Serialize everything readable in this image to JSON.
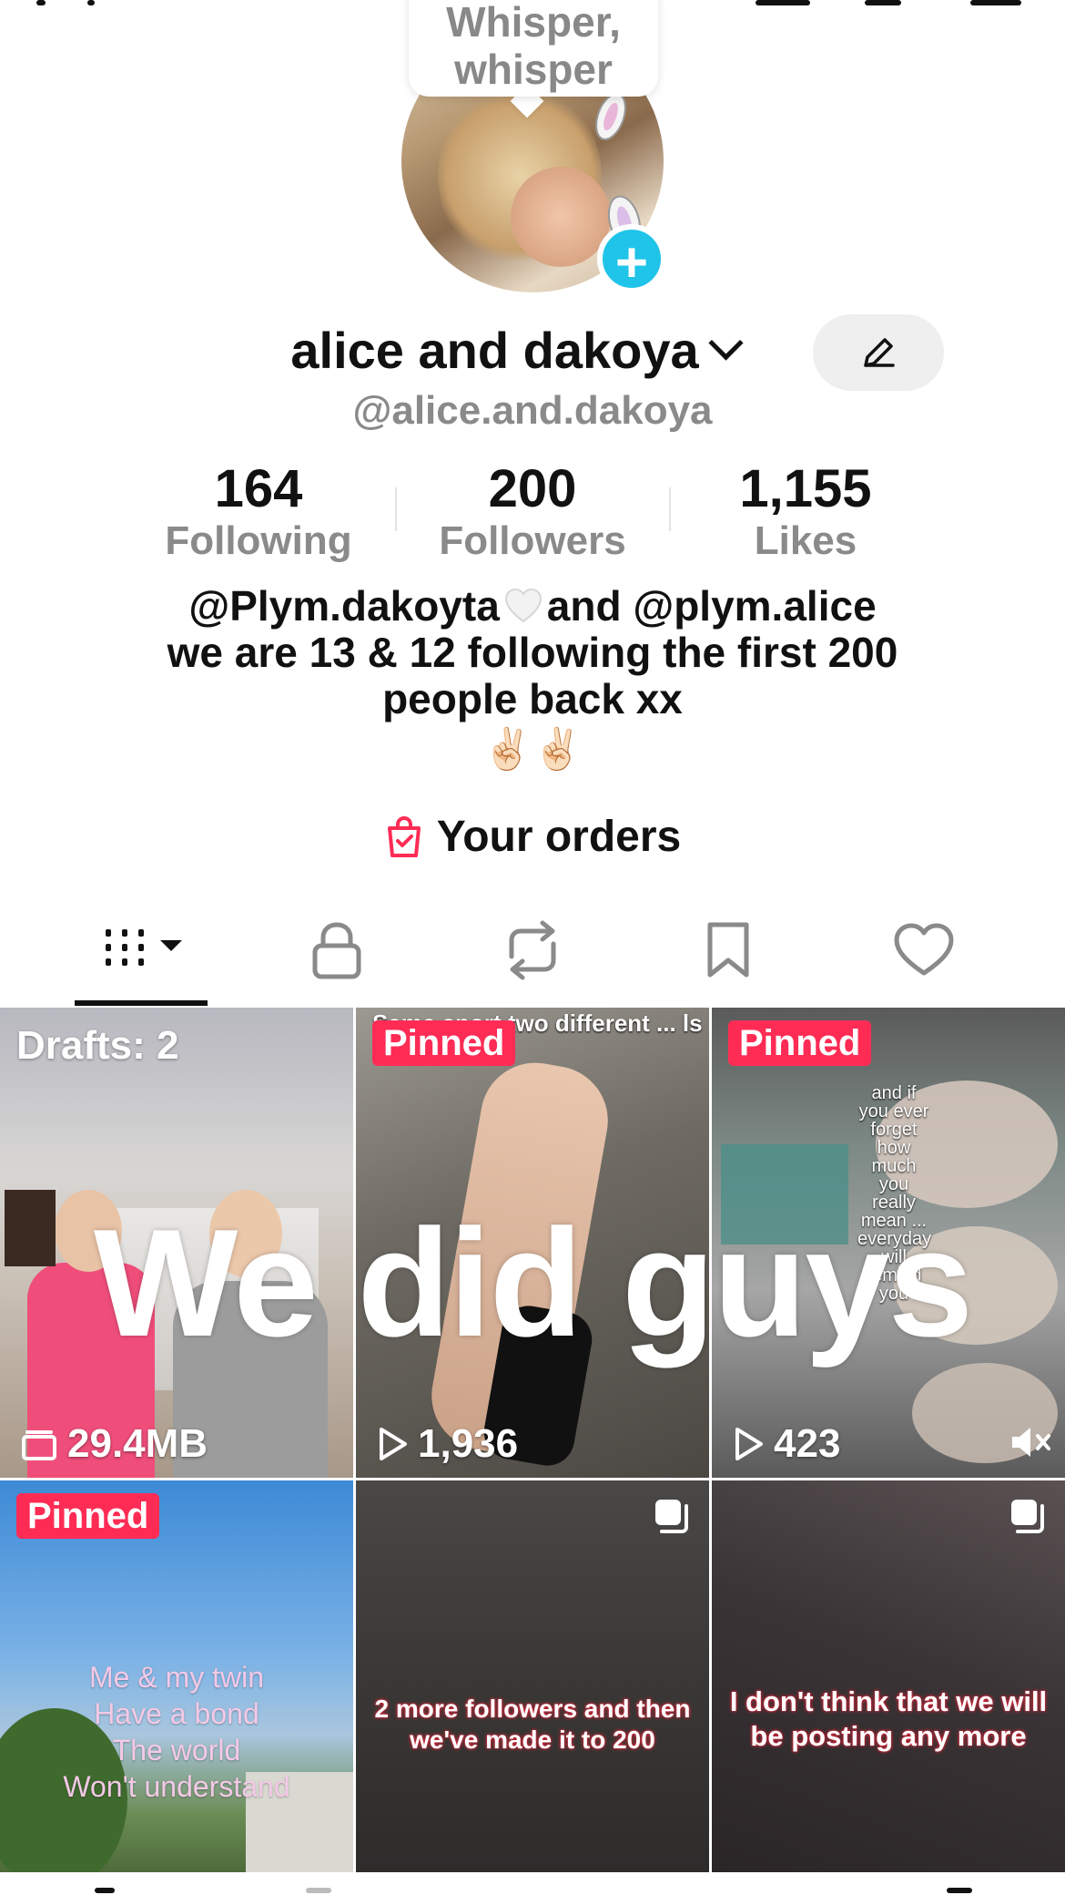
{
  "bubble": {
    "line1": "Whisper,",
    "line2": "whisper"
  },
  "profile": {
    "name": "alice and dakoya",
    "handle": "@alice.and.dakoya"
  },
  "stats": [
    {
      "value": "164",
      "label": "Following"
    },
    {
      "value": "200",
      "label": "Followers"
    },
    {
      "value": "1,155",
      "label": "Likes"
    }
  ],
  "bio": {
    "line1_a": "@Plym.dakoyta",
    "line1_b": "and @plym.alice",
    "line2": "we are 13 & 12 following the first 200",
    "line3": "people back xx",
    "line4": "✌🏻✌🏻"
  },
  "orders": {
    "label": "Your orders"
  },
  "tabs": [
    "videos-grid",
    "private",
    "reposts",
    "favorites",
    "liked"
  ],
  "grid": [
    {
      "badge": "Drafts: 2",
      "footer": "29.4MB"
    },
    {
      "badge": "Pinned",
      "caption": "Same sport two different ... ls",
      "views": "1,936"
    },
    {
      "badge": "Pinned",
      "caption": "and if you ever forget how much you really mean ... everyday will remind you",
      "views": "423"
    },
    {
      "badge": "Pinned",
      "caption_lines": [
        "Me & my twin",
        "Have a bond",
        "The world",
        "Won't understand"
      ]
    },
    {
      "caption_lines": [
        "2 more followers and then",
        "we've made it to 200"
      ]
    },
    {
      "caption_lines": [
        "I don't think that we will",
        "be posting any more"
      ]
    }
  ],
  "overlay": {
    "big_text": "We did guys"
  },
  "colors": {
    "accent_pinned": "#fe2c55",
    "plus_button": "#20c4e8",
    "muted_text": "#8a8a8a"
  }
}
